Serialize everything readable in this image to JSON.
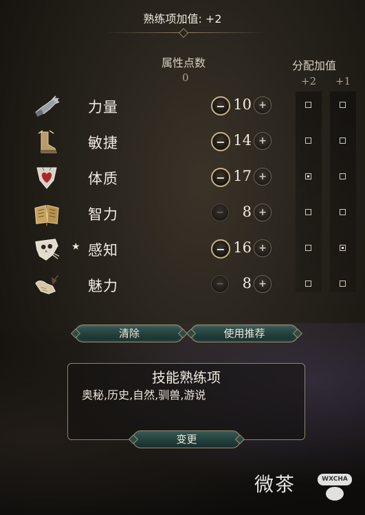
{
  "header": {
    "title": "熟练项加值: +2"
  },
  "columns": {
    "attribute_points_label": "属性点数",
    "attribute_points_value": "0",
    "allocation_label": "分配加值",
    "alloc_plus2": "+2",
    "alloc_plus1": "+1"
  },
  "attributes": [
    {
      "label": "力量",
      "value": "10",
      "star": "",
      "icon": "gauntlet-icon",
      "minus_enabled": true,
      "plus2_checked": false,
      "plus1_checked": false
    },
    {
      "label": "敏捷",
      "value": "14",
      "star": "",
      "icon": "boot-icon",
      "minus_enabled": true,
      "plus2_checked": false,
      "plus1_checked": false
    },
    {
      "label": "体质",
      "value": "17",
      "star": "",
      "icon": "heart-shield-icon",
      "minus_enabled": true,
      "plus2_checked": true,
      "plus1_checked": false
    },
    {
      "label": "智力",
      "value": "8",
      "star": "",
      "icon": "book-icon",
      "minus_enabled": false,
      "plus2_checked": false,
      "plus1_checked": false
    },
    {
      "label": "感知",
      "value": "16",
      "star": "★",
      "icon": "owl-icon",
      "minus_enabled": true,
      "plus2_checked": false,
      "plus1_checked": true
    },
    {
      "label": "魅力",
      "value": "8",
      "star": "",
      "icon": "hand-flower-icon",
      "minus_enabled": false,
      "plus2_checked": false,
      "plus1_checked": false
    }
  ],
  "buttons": {
    "minus": "−",
    "plus": "+",
    "clear": "清除",
    "recommend": "使用推荐",
    "change": "变更"
  },
  "skills": {
    "title": "技能熟练项",
    "list": "奥秘,历史,自然,驯兽,游说"
  },
  "watermark": {
    "text": "微茶",
    "badge": "WXCHA"
  }
}
